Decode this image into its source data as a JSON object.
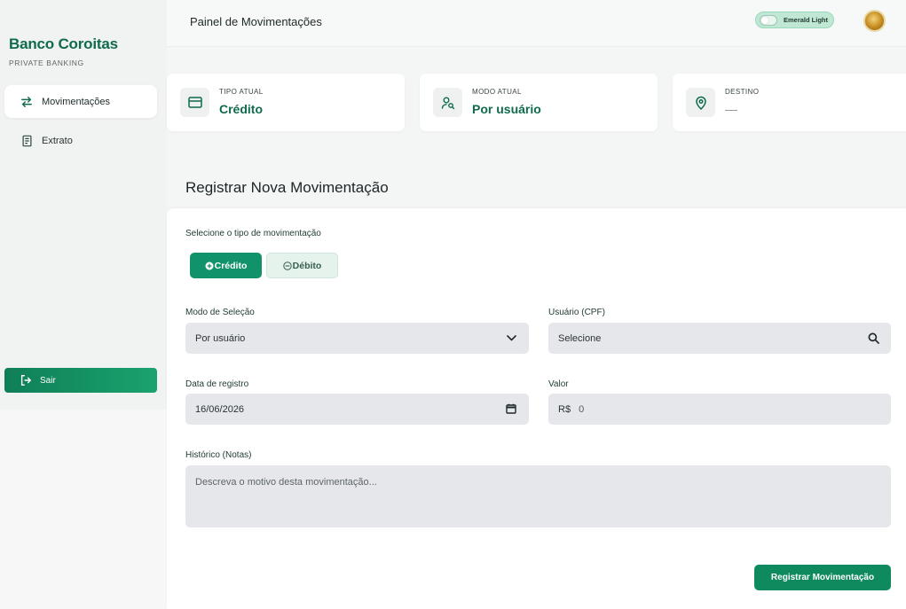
{
  "brand": {
    "name": "Banco Coroitas",
    "subtitle": "PRIVATE BANKING"
  },
  "sidebar": {
    "items": [
      {
        "label": "Movimentações",
        "icon": "swap-arrows-icon",
        "active": true
      },
      {
        "label": "Extrato",
        "icon": "receipt-icon",
        "active": false
      }
    ],
    "logout_label": "Sair"
  },
  "header": {
    "title": "Painel de Movimentações",
    "theme_label": "Emerald Light"
  },
  "cards": [
    {
      "label": "TIPO ATUAL",
      "value": "Crédito",
      "icon": "credit-card-icon"
    },
    {
      "label": "MODO ATUAL",
      "value": "Por usuário",
      "icon": "user-search-icon"
    },
    {
      "label": "DESTINO",
      "value": "—",
      "icon": "location-pin-icon"
    }
  ],
  "form": {
    "title": "Registrar Nova Movimentação",
    "type_label": "Selecione o tipo de movimentação",
    "type_options": {
      "credit": "Crédito",
      "debit": "Débito",
      "selected": "credit"
    },
    "mode_label": "Modo de Seleção",
    "mode_value": "Por usuário",
    "user_label": "Usuário (CPF)",
    "user_value": "Selecione",
    "date_label": "Data de registro",
    "date_value": "16/06/2026",
    "amount_label": "Valor",
    "currency_prefix": "R$",
    "amount_value": "0",
    "notes_label": "Histórico (Notas)",
    "notes_placeholder": "Descreva o motivo desta movimentação...",
    "submit_label": "Registrar Movimentação"
  },
  "colors": {
    "accent": "#0f6b4c",
    "button": "#12926a",
    "field_bg": "#e6e7ea"
  }
}
